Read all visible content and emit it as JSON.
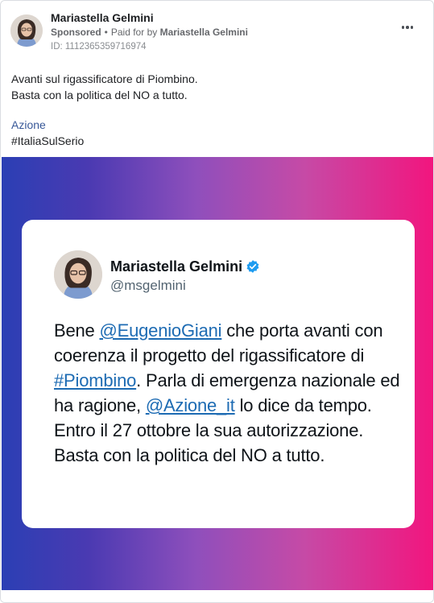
{
  "advertiser": {
    "name": "Mariastella Gelmini",
    "sponsored_label": "Sponsored",
    "paid_for_prefix": "Paid for by",
    "paid_for_name": "Mariastella Gelmini",
    "ad_id": "ID: 1112365359716974"
  },
  "post": {
    "line1": "Avanti sul rigassificatore di Piombino.",
    "line2": "Basta con la politica del NO a tutto.",
    "link_text": "Azione",
    "hashtag": "#ItaliaSulSerio"
  },
  "tweet": {
    "name": "Mariastella Gelmini",
    "handle": "@msgelmini",
    "w1": "Bene ",
    "m1": "@EugenioGiani",
    "w2": " che porta avanti con coerenza il progetto del rigassificatore di ",
    "h1": "#Piombino",
    "w3": ". Parla di emergenza nazionale ed ha ragione, ",
    "m2": "@Azione_it",
    "w4": " lo dice da tempo. Entro il 27 ottobre la sua autorizzazione. Basta con la politica del NO a tutto."
  },
  "icons": {
    "more": "more-options-icon",
    "verified": "verified-badge-icon",
    "avatar": "profile-avatar"
  },
  "colors": {
    "link": "#385898",
    "tweet_link": "#1d6bb3",
    "gradient_start": "#2b3fb4",
    "gradient_end": "#f2157e"
  }
}
